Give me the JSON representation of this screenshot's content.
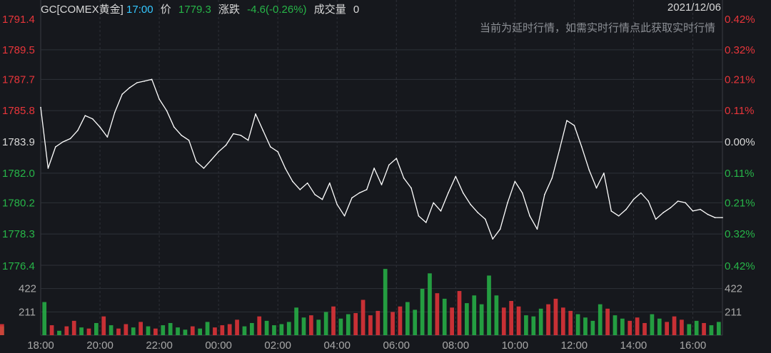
{
  "header": {
    "symbol": "GC[COMEX黄金]",
    "time": "17:00",
    "price_label": "价",
    "price": "1779.3",
    "change_label": "涨跌",
    "change": "-4.6(-0.26%)",
    "volume_label": "成交量",
    "volume": "0",
    "date": "2021/12/06"
  },
  "notice": "当前为延时行情，如需实时行情点此获取实时行情",
  "colors": {
    "background": "#16181d",
    "up": "#e8353a",
    "down": "#27b548",
    "line": "#ffffff",
    "text": "#d8d8d8",
    "time": "#34c7ff",
    "axis": "#a8a8a8",
    "grid": "#2e3138"
  },
  "chart_data": {
    "type": "line",
    "base_price": 1783.9,
    "price_axis": {
      "ticks": [
        "1791.4",
        "1789.5",
        "1787.7",
        "1785.8",
        "1783.9",
        "1782.0",
        "1780.2",
        "1778.3",
        "1776.4"
      ],
      "values": [
        1791.4,
        1789.5,
        1787.7,
        1785.8,
        1783.9,
        1782.0,
        1780.2,
        1778.3,
        1776.4
      ],
      "right_ticks": [
        "0.42%",
        "0.32%",
        "0.21%",
        "0.11%",
        "0.00%",
        "0.11%",
        "0.21%",
        "0.32%",
        "0.42%"
      ],
      "ylim": [
        1776.4,
        1791.4
      ]
    },
    "time_axis": {
      "labels": [
        "18:00",
        "20:00",
        "22:00",
        "00:00",
        "02:00",
        "04:00",
        "06:00",
        "08:00",
        "10:00",
        "12:00",
        "14:00",
        "16:00"
      ],
      "xlim": [
        0,
        23
      ]
    },
    "price_series": {
      "x": [
        0,
        0.25,
        0.5,
        0.75,
        1,
        1.25,
        1.5,
        1.75,
        2,
        2.25,
        2.5,
        2.75,
        3,
        3.25,
        3.5,
        3.75,
        4,
        4.25,
        4.5,
        4.75,
        5,
        5.25,
        5.5,
        5.75,
        6,
        6.25,
        6.5,
        6.75,
        7,
        7.25,
        7.5,
        7.75,
        8,
        8.25,
        8.5,
        8.75,
        9,
        9.25,
        9.5,
        9.75,
        10,
        10.25,
        10.5,
        10.75,
        11,
        11.25,
        11.5,
        11.75,
        12,
        12.25,
        12.5,
        12.75,
        13,
        13.25,
        13.5,
        13.75,
        14,
        14.25,
        14.5,
        14.75,
        15,
        15.25,
        15.5,
        15.75,
        16,
        16.25,
        16.5,
        16.75,
        17,
        17.25,
        17.5,
        17.75,
        18,
        18.25,
        18.5,
        18.75,
        19,
        19.25,
        19.5,
        19.75,
        20,
        20.25,
        20.5,
        20.75,
        21,
        21.25,
        21.5,
        21.75,
        22,
        22.25,
        22.5,
        22.75,
        23
      ],
      "values": [
        1786.0,
        1782.3,
        1783.6,
        1783.9,
        1784.1,
        1784.6,
        1785.5,
        1785.3,
        1784.8,
        1784.2,
        1785.7,
        1786.8,
        1787.2,
        1787.5,
        1787.6,
        1787.7,
        1786.5,
        1785.8,
        1784.8,
        1784.3,
        1784.0,
        1782.7,
        1782.3,
        1782.8,
        1783.3,
        1783.7,
        1784.4,
        1784.3,
        1784.0,
        1785.6,
        1784.6,
        1783.6,
        1783.3,
        1782.3,
        1781.5,
        1781.0,
        1781.4,
        1780.7,
        1780.4,
        1781.4,
        1780.1,
        1779.4,
        1780.5,
        1780.8,
        1781.0,
        1782.3,
        1781.3,
        1782.5,
        1782.9,
        1781.7,
        1781.1,
        1779.4,
        1779.0,
        1780.2,
        1779.7,
        1780.8,
        1781.8,
        1780.8,
        1780.1,
        1779.6,
        1779.2,
        1778.0,
        1778.6,
        1780.2,
        1781.5,
        1780.8,
        1779.4,
        1778.6,
        1780.7,
        1781.7,
        1783.4,
        1785.2,
        1784.9,
        1783.6,
        1782.2,
        1781.1,
        1782.0,
        1779.7,
        1779.4,
        1779.8,
        1780.4,
        1780.8,
        1780.3,
        1779.2,
        1779.6,
        1779.9,
        1780.3,
        1780.2,
        1779.7,
        1779.8,
        1779.5,
        1779.3,
        1779.3
      ]
    },
    "volume_axis": {
      "ticks": [
        "422",
        "211"
      ],
      "values": [
        422,
        211
      ],
      "ylim": [
        0,
        633
      ]
    },
    "volume_series": {
      "x": [
        0,
        0.25,
        0.5,
        0.75,
        1,
        1.25,
        1.5,
        1.75,
        2,
        2.25,
        2.5,
        2.75,
        3,
        3.25,
        3.5,
        3.75,
        4,
        4.25,
        4.5,
        4.75,
        5,
        5.25,
        5.5,
        5.75,
        6,
        6.25,
        6.5,
        6.75,
        7,
        7.25,
        7.5,
        7.75,
        8,
        8.25,
        8.5,
        8.75,
        9,
        9.25,
        9.5,
        9.75,
        10,
        10.25,
        10.5,
        10.75,
        11,
        11.25,
        11.5,
        11.75,
        12,
        12.25,
        12.5,
        12.75,
        13,
        13.25,
        13.5,
        13.75,
        14,
        14.25,
        14.5,
        14.75,
        15,
        15.25,
        15.5,
        15.75,
        16,
        16.25,
        16.5,
        16.75,
        17,
        17.25,
        17.5,
        17.75,
        18,
        18.25,
        18.5,
        18.75,
        19,
        19.25,
        19.5,
        19.75,
        20,
        20.25,
        20.5,
        20.75,
        21,
        21.25,
        21.5,
        21.75,
        22,
        22.25,
        22.5,
        22.75
      ],
      "values": [
        300,
        90,
        40,
        80,
        130,
        70,
        60,
        110,
        170,
        90,
        60,
        100,
        70,
        120,
        80,
        60,
        90,
        110,
        70,
        50,
        80,
        60,
        120,
        70,
        90,
        100,
        140,
        80,
        110,
        170,
        130,
        90,
        100,
        120,
        250,
        160,
        180,
        140,
        210,
        260,
        150,
        190,
        200,
        320,
        180,
        220,
        600,
        210,
        260,
        300,
        230,
        420,
        560,
        380,
        330,
        250,
        400,
        290,
        360,
        280,
        540,
        360,
        250,
        310,
        260,
        180,
        170,
        240,
        280,
        330,
        250,
        220,
        190,
        160,
        130,
        280,
        240,
        180,
        150,
        130,
        160,
        110,
        190,
        150,
        120,
        170,
        140,
        100,
        130,
        110,
        90,
        120,
        80,
        100
      ],
      "direction": [
        "down",
        "up",
        "down",
        "up",
        "up",
        "down",
        "up",
        "down",
        "up",
        "down",
        "up",
        "up",
        "down",
        "up",
        "down",
        "up",
        "down",
        "down",
        "down",
        "down",
        "up",
        "down",
        "down",
        "up",
        "up",
        "up",
        "up",
        "down",
        "down",
        "up",
        "down",
        "down",
        "down",
        "down",
        "down",
        "down",
        "up",
        "down",
        "down",
        "up",
        "down",
        "down",
        "up",
        "up",
        "up",
        "up",
        "down",
        "up",
        "up",
        "down",
        "down",
        "down",
        "down",
        "up",
        "down",
        "up",
        "up",
        "down",
        "down",
        "down",
        "down",
        "down",
        "up",
        "up",
        "up",
        "down",
        "down",
        "down",
        "up",
        "up",
        "up",
        "up",
        "down",
        "down",
        "down",
        "down",
        "up",
        "down",
        "down",
        "up",
        "up",
        "up",
        "down",
        "down",
        "up",
        "up",
        "up",
        "down",
        "down",
        "up",
        "down",
        "down",
        "down",
        "up"
      ]
    }
  }
}
